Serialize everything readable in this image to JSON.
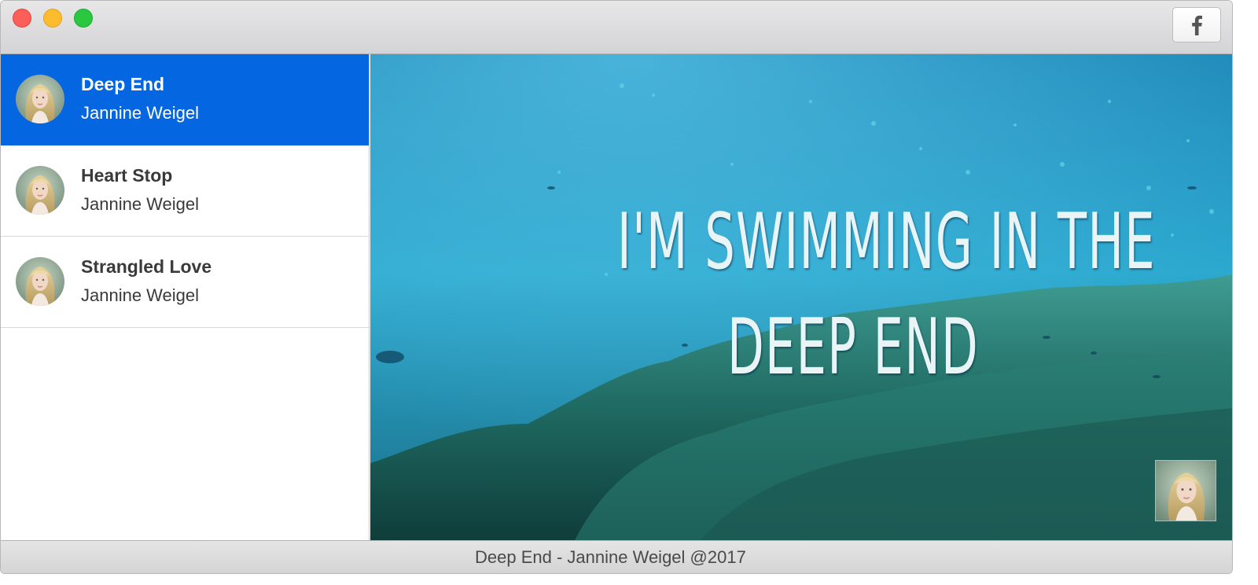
{
  "window": {
    "controls": [
      "close",
      "minimize",
      "maximize"
    ]
  },
  "toolbar": {
    "facebook_icon": "facebook-icon"
  },
  "playlist": {
    "selected_index": 0,
    "items": [
      {
        "title": "Deep End",
        "artist": "Jannine Weigel"
      },
      {
        "title": "Heart Stop",
        "artist": "Jannine Weigel"
      },
      {
        "title": "Strangled Love",
        "artist": "Jannine Weigel"
      }
    ]
  },
  "player": {
    "lyrics_line1": "I'M SWIMMING IN THE",
    "lyrics_line2": "DEEP END"
  },
  "status": {
    "now_playing": "Deep End - Jannine Weigel @2017"
  },
  "colors": {
    "selection": "#0466e0",
    "text": "#3a3a3a",
    "close": "#fc5f57",
    "minimize": "#fdbc2e",
    "maximize": "#29c840"
  }
}
